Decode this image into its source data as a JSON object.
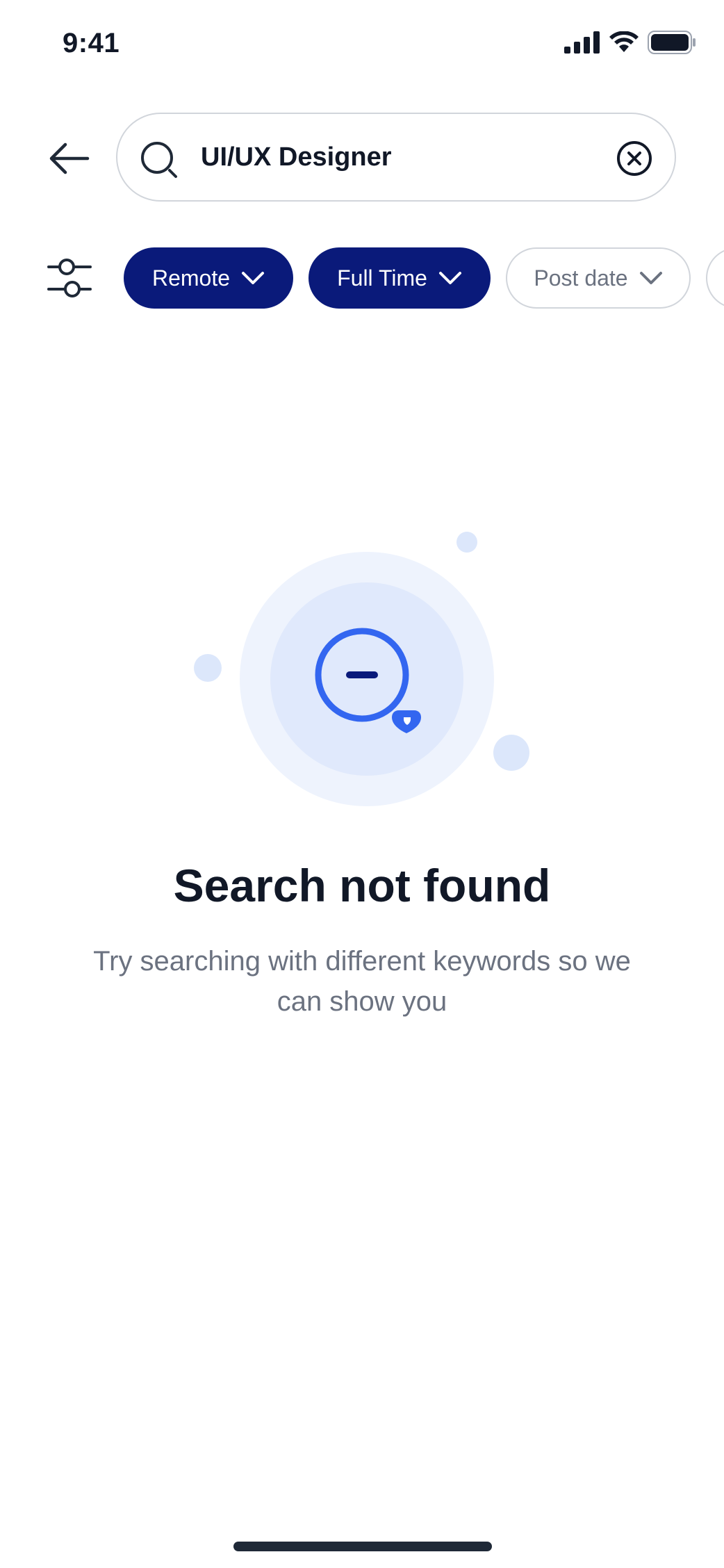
{
  "status_bar": {
    "time": "9:41"
  },
  "search": {
    "value": "UI/UX Designer",
    "placeholder": ""
  },
  "filters": {
    "chips": [
      {
        "label": "Remote",
        "active": true
      },
      {
        "label": "Full Time",
        "active": true
      },
      {
        "label": "Post date",
        "active": false
      }
    ]
  },
  "empty_state": {
    "title": "Search not found",
    "description": "Try searching with different keywords so we can show you"
  },
  "icons": {
    "back": "arrow-left-icon",
    "search": "search-icon",
    "clear": "close-circle-icon",
    "filter": "sliders-icon",
    "chevron": "chevron-down-icon"
  },
  "colors": {
    "primary": "#0a1a7a",
    "accent": "#3366f0",
    "light_blue": "#e0e9fc",
    "lighter_blue": "#eef3fd",
    "text_dark": "#111827",
    "text_muted": "#6b7280",
    "border": "#d1d5db"
  }
}
